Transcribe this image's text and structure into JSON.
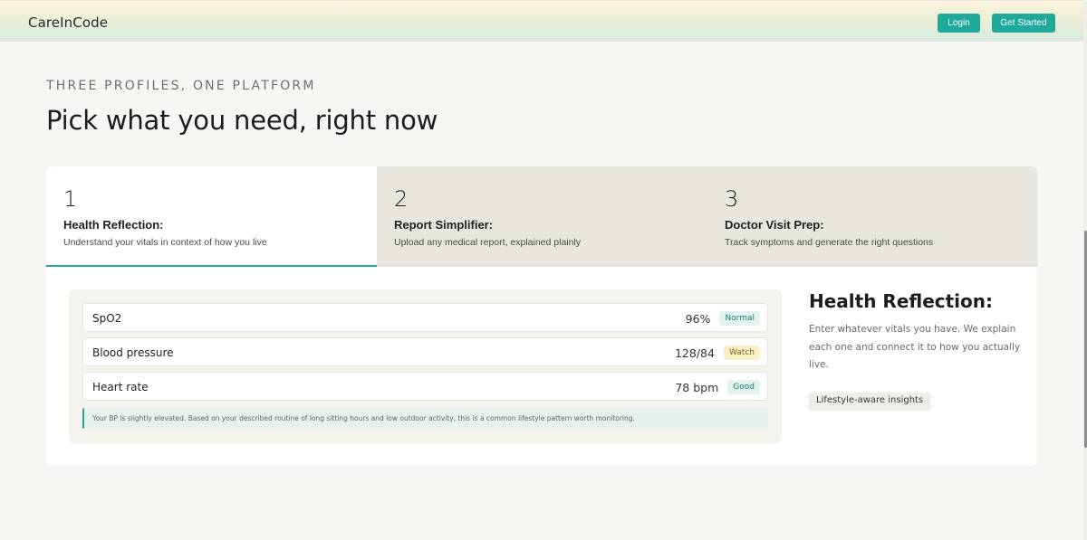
{
  "header": {
    "brand": "CareInCode",
    "login_label": "Login",
    "get_started_label": "Get Started"
  },
  "section": {
    "eyebrow": "THREE PROFILES, ONE PLATFORM",
    "title": "Pick what you need, right now"
  },
  "tabs": [
    {
      "number": "1",
      "name": "Health Reflection:",
      "description": "Understand your vitals in context of how you live",
      "active": true
    },
    {
      "number": "2",
      "name": "Report Simplifier:",
      "description": "Upload any medical report, explained plainly",
      "active": false
    },
    {
      "number": "3",
      "name": "Doctor Visit Prep:",
      "description": "Track symptoms and generate the right questions",
      "active": false
    }
  ],
  "vitals": [
    {
      "name": "SpO2",
      "value": "96%",
      "status": "Normal"
    },
    {
      "name": "Blood pressure",
      "value": "128/84",
      "status": "Watch"
    },
    {
      "name": "Heart rate",
      "value": "78 bpm",
      "status": "Good"
    }
  ],
  "note": "Your BP is slightly elevated. Based on your described routine of long sitting hours and low outdoor activity, this is a common lifestyle pattern worth monitoring.",
  "info": {
    "title": "Health Reflection:",
    "description": "Enter whatever vitals you have. We explain each one and connect it to how you actually live.",
    "chip": "Lifestyle-aware insights"
  },
  "colors": {
    "accent": "#1fa99a",
    "background": "#f7f6f2",
    "tab_inactive": "#e8e6df",
    "badge_watch": "#fbf1c9",
    "badge_normal": "#e3f3ef"
  }
}
